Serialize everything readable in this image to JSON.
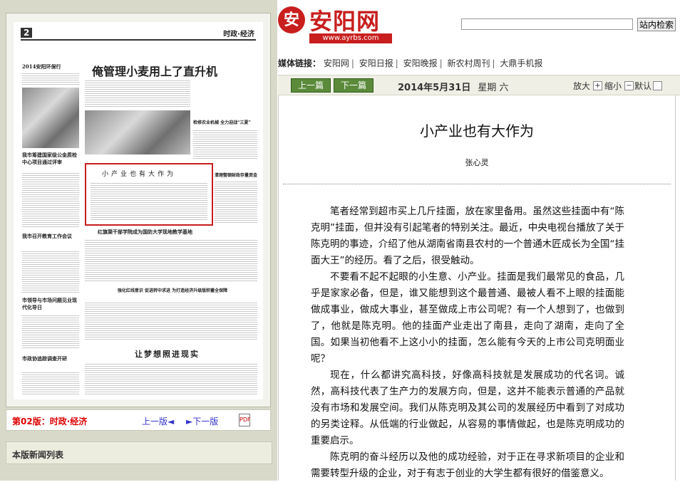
{
  "newspaper": {
    "page_number": "2",
    "section": "时政·经济",
    "headlines": {
      "main": "俺管理小麦用上了直升机",
      "side1": "2014安阳环保行",
      "side2": "我市筹建国家级公金质检中心项目通过评审",
      "side3": "我市召开教育工作会议",
      "highlight": "小产业也有大作为",
      "right1": "检修农业机械 全力迎战“三夏”",
      "right2": "清理整顿财政存量资金",
      "mid": "红旗渠干部学院成为国防大学现地教学基地",
      "mid2": "强化红线意识 促进转中求进 为打造经济升级版积蓄全保障",
      "bottom": "让梦想照进现实",
      "left4": "市领导与市场问题见业现代化导日",
      "left5": "市政协追踪调查开研"
    }
  },
  "page_nav": {
    "version": "第02版：时政·经济",
    "prev": "上一版◄",
    "next": "►下一版"
  },
  "news_list": {
    "title": "本版新闻列表"
  },
  "site": {
    "logo_text": "安阳网",
    "logo_url": "www.ayrbs.com",
    "search_button": "站内检索",
    "search_placeholder": ""
  },
  "media_links": {
    "label": "媒体链接：",
    "items": [
      "安阳网",
      "安阳日报",
      "安阳晚报",
      "新农村周刊",
      "大鼎手机报"
    ]
  },
  "toolbar": {
    "prev": "上一篇",
    "next": "下一篇",
    "date": "2014年5月31日",
    "weekday": "星期 六",
    "zoom_in": "放大",
    "zoom_out": "缩小",
    "default": "默认"
  },
  "article": {
    "title": "小产业也有大作为",
    "author": "张心灵",
    "paragraphs": [
      "笔者经常到超市买上几斤挂面，放在家里备用。虽然这些挂面中有“陈克明”挂面，但并没有引起笔者的特别关注。最近，中央电视台播放了关于陈克明的事迹，介绍了他从湖南省南县农村的一个普通木匠成长为全国“挂面大王”的经历。看了之后，很受触动。",
      "不要看不起不起眼的小生意、小产业。挂面是我们最常见的食品，几乎是家家必备，但是，谁又能想到这个最普通、最被人看不上眼的挂面能做成事业，做成大事业，甚至做成上市公司呢？有一个人想到了，也做到了，他就是陈克明。他的挂面产业走出了南县，走向了湖南，走向了全国。如果当初他看不上这小小的挂面，怎么能有今天的上市公司克明面业呢？",
      "现在，什么都讲究高科技，好像高科技就是发展成功的代名词。诚然，高科技代表了生产力的发展方向，但是，这并不能表示普通的产品就没有市场和发展空间。我们从陈克明及其公司的发展经历中看到了对成功的另类诠释。从低端的行业做起，从容易的事情做起，也是陈克明成功的重要启示。",
      "陈克明的奋斗经历以及他的成功经验，对于正在寻求新项目的企业和需要转型升级的企业，对于有志于创业的大学生都有很好的借鉴意义。"
    ]
  },
  "colors": {
    "brand_red": "#c81e1e",
    "button_green": "#5a8a3a",
    "version_red": "#dd0000",
    "link_blue": "#3333cc"
  }
}
